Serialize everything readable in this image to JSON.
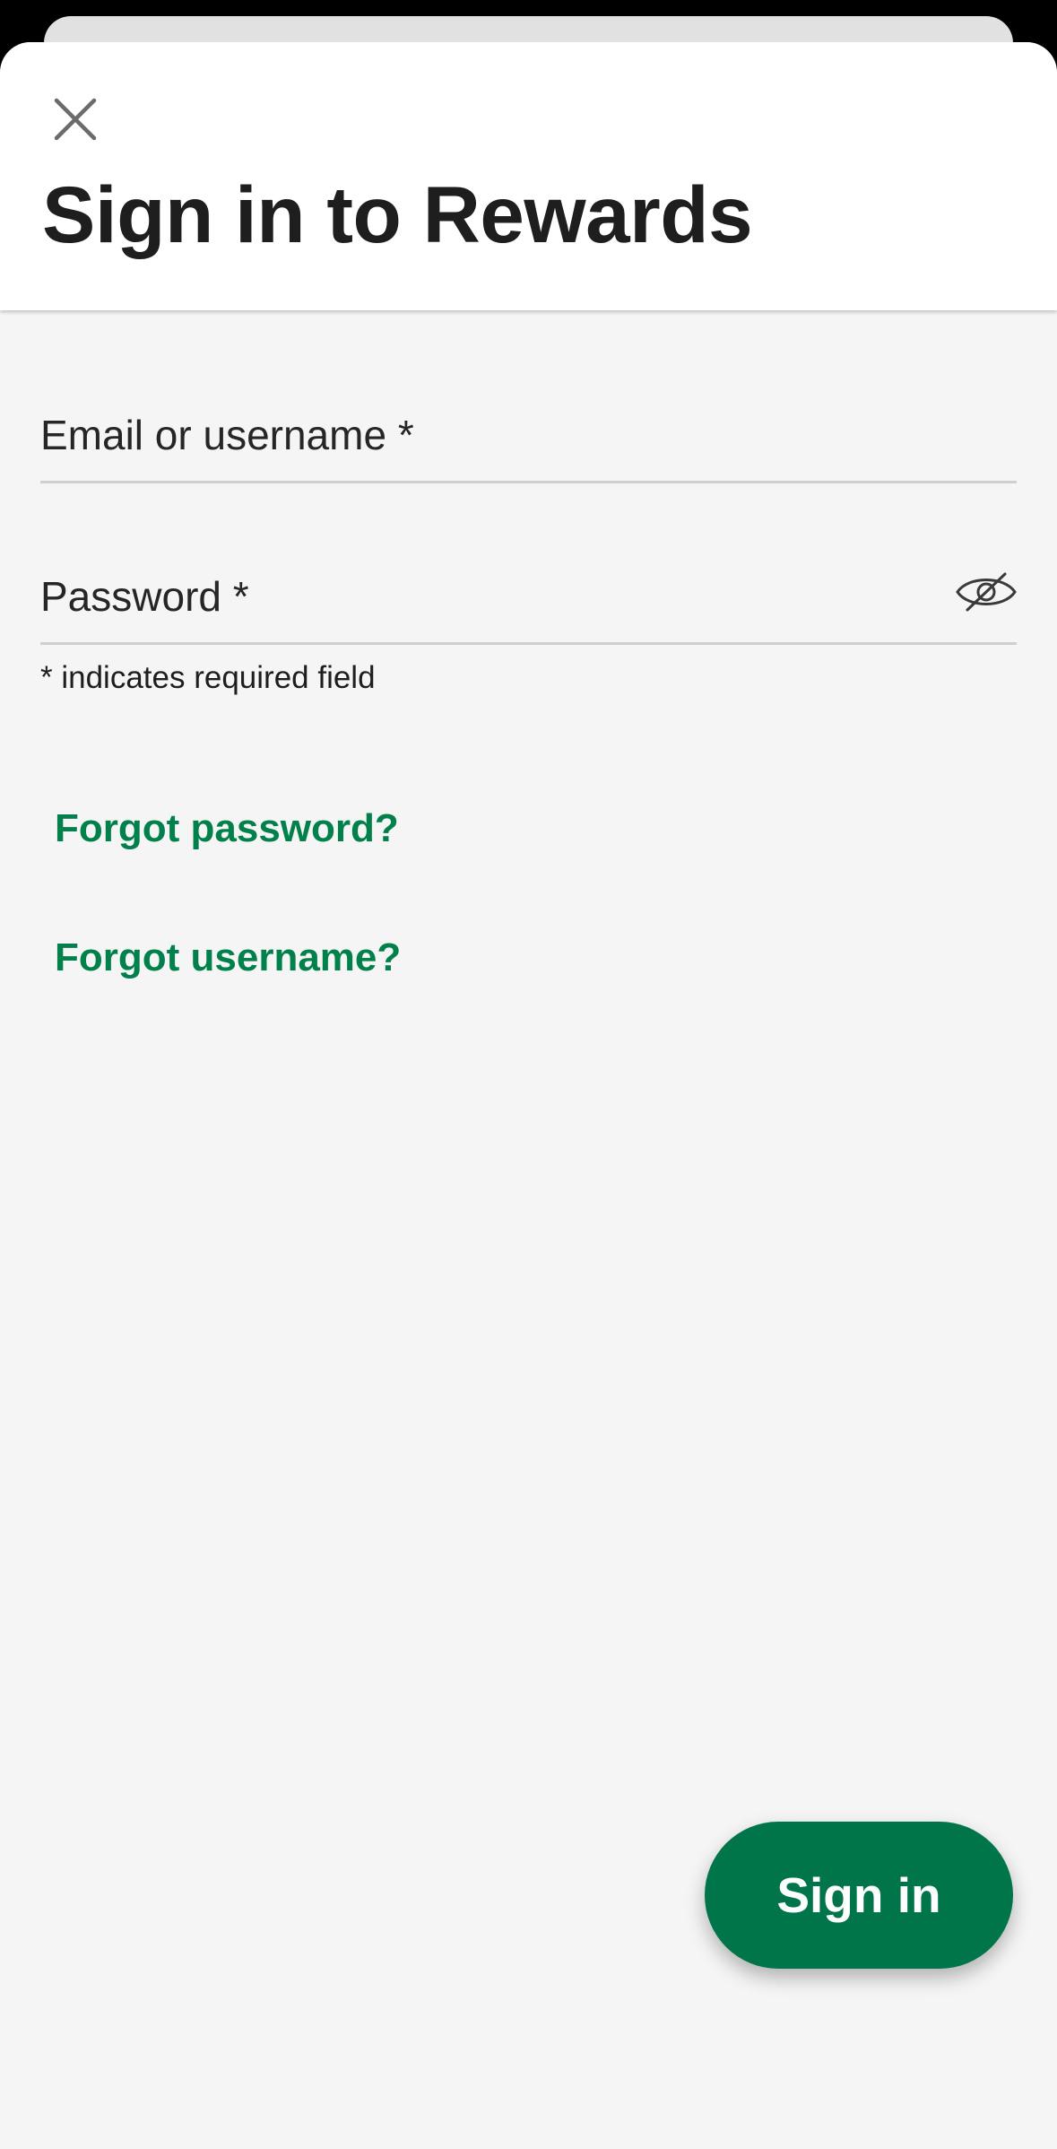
{
  "header": {
    "title": "Sign in to Rewards",
    "close_icon": "close-icon"
  },
  "form": {
    "email": {
      "label": "Email or username *",
      "value": ""
    },
    "password": {
      "label": "Password *",
      "value": "",
      "toggle_icon": "eye-slash-icon"
    },
    "required_note": "* indicates required field"
  },
  "links": {
    "forgot_password": "Forgot password?",
    "forgot_username": "Forgot username?"
  },
  "actions": {
    "sign_in_label": "Sign in"
  },
  "colors": {
    "brand_green": "#00754a",
    "link_green": "#00804a",
    "sheet_background": "#f5f5f5",
    "header_background": "#ffffff"
  }
}
